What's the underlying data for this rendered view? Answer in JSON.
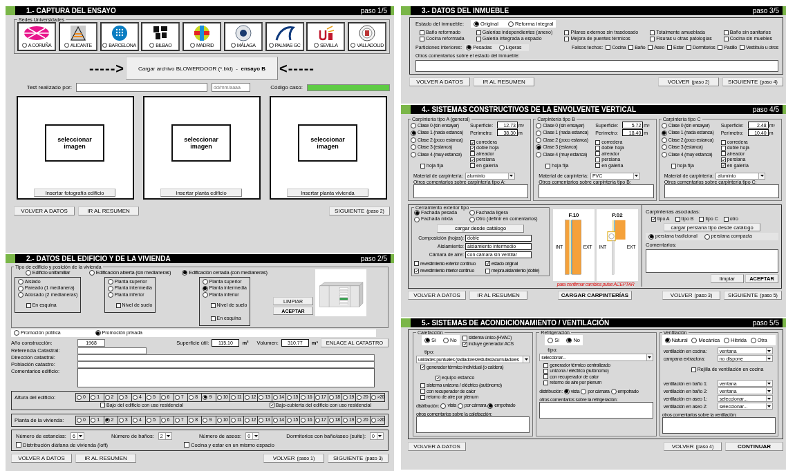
{
  "capture": {
    "title": "1.- CAPTURA DEL ENSAYO",
    "step": "paso 1/5",
    "sedes_label": "Sedes Universidades",
    "sedes": [
      {
        "label": "A CORUÑA",
        "selected": false
      },
      {
        "label": "ALICANTE",
        "selected": false
      },
      {
        "label": "BARCELONA",
        "selected": false
      },
      {
        "label": "BILBAO",
        "selected": false
      },
      {
        "label": "MADRID",
        "selected": false
      },
      {
        "label": "MÁLAGA",
        "selected": false
      },
      {
        "label": "PALMAS GC",
        "selected": false
      },
      {
        "label": "SEVILLA",
        "selected": false
      },
      {
        "label": "VALLADOLID",
        "selected": false
      }
    ],
    "arrow_left": "----->",
    "load_button": "Cargar archivo BLOWERDOOR (*.bld)  -  **ensayo B**",
    "arrow_right": "<-----",
    "tester_label": "Test realizado por:",
    "date_placeholder": "dd/mm/aaaa",
    "code_label": "Código caso:",
    "images": [
      {
        "prompt": "seleccionar imagen",
        "button": "Insertar fotografía edificio"
      },
      {
        "prompt": "seleccionar imagen",
        "button": "Insertar planta edificio"
      },
      {
        "prompt": "seleccionar imagen",
        "button": "Insertar planta vivienda"
      }
    ],
    "nav_left": [
      {
        "label": "VOLVER A DATOS",
        "strong": false
      },
      {
        "label": "IR AL RESUMEN",
        "strong": false
      }
    ],
    "nav_right": [
      {
        "label": "SIGUIENTE",
        "note": "(paso 2)",
        "strong": false
      }
    ]
  },
  "building": {
    "title": "2.- DATOS DEL EDIFICIO Y DE LA VIVIENDA",
    "step": "paso 2/5",
    "group_label": "Tipo de edificio y posición de la vivienda",
    "types": [
      {
        "label": "Edificio unifamiliar",
        "selected": false,
        "options": [
          {
            "label": "Aislado",
            "selected": false
          },
          {
            "label": "Pareado (1 medianera)",
            "selected": false
          },
          {
            "label": "Adosado (2 medianeras)",
            "selected": false
          }
        ],
        "checks": [
          {
            "label": "En esquina",
            "checked": false
          }
        ]
      },
      {
        "label": "Edificación abierta (sin medianeras)",
        "selected": false,
        "options": [
          {
            "label": "Planta superior",
            "selected": false
          },
          {
            "label": "Planta intermedia",
            "selected": false
          },
          {
            "label": "Planta inferior",
            "selected": false
          }
        ],
        "checks": [
          {
            "label": "Nivel de suelo",
            "checked": false
          }
        ]
      },
      {
        "label": "Edificación cerrada (con medianeras)",
        "selected": true,
        "options": [
          {
            "label": "Planta superior",
            "selected": false
          },
          {
            "label": "Planta intermedia",
            "selected": true
          },
          {
            "label": "Planta inferior",
            "selected": false
          }
        ],
        "checks": [
          {
            "label": "Nivel de suelo",
            "checked": false
          },
          {
            "label": "En esquina",
            "checked": false
          }
        ]
      }
    ],
    "type_buttons": [
      {
        "label": "LIMPIAR",
        "strong": false
      },
      {
        "label": "ACEPTAR",
        "strong": true
      }
    ],
    "promotion": [
      {
        "label": "Promoción pública",
        "selected": false
      },
      {
        "label": "Promoción privada",
        "selected": true
      }
    ],
    "year_label": "Año construcción:",
    "year": "1968",
    "area_label": "Superficie útil:",
    "area": "115.10",
    "area_unit": "m²",
    "volume_label": "Volumen:",
    "volume": "310.77",
    "volume_unit": "m³",
    "catastro_button": "ENLACE AL CATASTRO",
    "text_fields": [
      {
        "label": "Referencia Catastral:",
        "kind": "short"
      },
      {
        "label": "Dirección catastral:",
        "kind": "line"
      },
      {
        "label": "Población catastro:",
        "kind": "line"
      },
      {
        "label": "Comentarios edificio:",
        "kind": "area"
      }
    ],
    "height_label": "Altura del edificio:",
    "heights": [
      {
        "label": "0",
        "selected": false
      },
      {
        "label": "1",
        "selected": false
      },
      {
        "label": "2",
        "selected": false
      },
      {
        "label": "3",
        "selected": false
      },
      {
        "label": "4",
        "selected": false
      },
      {
        "label": "5",
        "selected": false
      },
      {
        "label": "6",
        "selected": false
      },
      {
        "label": "7",
        "selected": false
      },
      {
        "label": "8",
        "selected": false
      },
      {
        "label": "9",
        "selected": true
      },
      {
        "label": "10",
        "selected": false
      },
      {
        "label": "11",
        "selected": false
      },
      {
        "label": "12",
        "selected": false
      },
      {
        "label": "13",
        "selected": false
      },
      {
        "label": "14",
        "selected": false
      },
      {
        "label": "15",
        "selected": false
      },
      {
        "label": "16",
        "selected": false
      },
      {
        "label": "17",
        "selected": false
      },
      {
        "label": "18",
        "selected": false
      },
      {
        "label": "19",
        "selected": false
      },
      {
        "label": "20",
        "selected": false
      },
      {
        "label": ">20",
        "selected": false
      }
    ],
    "height_checks": [
      {
        "label": "Bajo del edificio con uso residencial",
        "checked": false
      },
      {
        "label": "Bajo-cubierta del edificio con uso residencial",
        "checked": true
      }
    ],
    "floor_label": "Planta de la vivienda:",
    "floors": [
      {
        "label": "0",
        "selected": false
      },
      {
        "label": "1",
        "selected": false
      },
      {
        "label": "2",
        "selected": true
      },
      {
        "label": "3",
        "selected": false
      },
      {
        "label": "4",
        "selected": false
      },
      {
        "label": "5",
        "selected": false
      },
      {
        "label": "6",
        "selected": false
      },
      {
        "label": "7",
        "selected": false
      },
      {
        "label": "8",
        "selected": false
      },
      {
        "label": "9",
        "selected": false
      },
      {
        "label": "10",
        "selected": false
      },
      {
        "label": "11",
        "selected": false
      },
      {
        "label": "12",
        "selected": false
      },
      {
        "label": "13",
        "selected": false
      },
      {
        "label": "14",
        "selected": false
      },
      {
        "label": "15",
        "selected": false
      },
      {
        "label": "16",
        "selected": false
      },
      {
        "label": "17",
        "selected": false
      },
      {
        "label": "18",
        "selected": false
      },
      {
        "label": "19",
        "selected": false
      },
      {
        "label": "20",
        "selected": false
      },
      {
        "label": ">20",
        "selected": false
      }
    ],
    "counts": [
      {
        "label": "Número de estancias:",
        "value": "6"
      },
      {
        "label": "Número de baños:",
        "value": "2"
      },
      {
        "label": "Número de aseos:",
        "value": "0"
      },
      {
        "label": "Dormitorios con baño/aseo (suite):",
        "value": "0"
      }
    ],
    "layout_checks": [
      {
        "label": "Distribución diáfana de vivienda (loft)",
        "checked": false
      },
      {
        "label": "Cocina y estar en un mismo espacio",
        "checked": false
      }
    ],
    "nav_left": [
      {
        "label": "VOLVER A DATOS",
        "strong": false
      },
      {
        "label": "IR AL RESUMEN",
        "strong": false
      }
    ],
    "nav_right": [
      {
        "label": "VOLVER",
        "note": "(paso 1)",
        "strong": false
      },
      {
        "label": "SIGUIENTE",
        "note": "(paso 3)",
        "strong": false
      }
    ]
  },
  "property": {
    "title": "3.- DATOS DEL INMUEBLE",
    "step": "paso 3/5",
    "state_label": "Estado del inmueble:",
    "states": [
      {
        "label": "Original",
        "selected": true
      },
      {
        "label": "Reforma integral",
        "selected": false
      }
    ],
    "features": [
      {
        "label": "Baño reformado",
        "checked": false
      },
      {
        "label": "Galerías independientes (anexo)",
        "checked": false
      },
      {
        "label": "Pilares externos sin trasdosado",
        "checked": false
      },
      {
        "label": "Totalmente amueblada",
        "checked": false
      },
      {
        "label": "Baño sin sanitarios",
        "checked": false
      },
      {
        "label": "Cocina reformada",
        "checked": false
      },
      {
        "label": "Galería integrada a espacio",
        "checked": false
      },
      {
        "label": "Mejora de puentes térmicos",
        "checked": false
      },
      {
        "label": "Fisuras u otras patologías",
        "checked": false
      },
      {
        "label": "Cocina sin muebles",
        "checked": false
      }
    ],
    "partitions_label": "Particiones interiores:",
    "partitions": [
      {
        "label": "Pesadas",
        "selected": true
      },
      {
        "label": "Ligeras",
        "selected": false
      }
    ],
    "ceilings_label": "Falsos techos:",
    "ceilings": [
      {
        "label": "Cocina",
        "checked": false
      },
      {
        "label": "Baño",
        "checked": false
      },
      {
        "label": "Aseo",
        "checked": false
      },
      {
        "label": "Estar",
        "checked": false
      },
      {
        "label": "Dormitorios",
        "checked": false
      },
      {
        "label": "Pasillo",
        "checked": false
      },
      {
        "label": "Vestíbulo u otros",
        "checked": false
      }
    ],
    "comments_label": "Otros comentarios sobre el estado del inmueble:",
    "nav_left": [
      {
        "label": "VOLVER A DATOS",
        "strong": false
      },
      {
        "label": "IR AL RESUMEN",
        "strong": false
      }
    ],
    "nav_right": [
      {
        "label": "VOLVER",
        "note": "(paso 2)",
        "strong": false
      },
      {
        "label": "SIGUIENTE",
        "note": "(paso 4)",
        "strong": false
      }
    ]
  },
  "envelope": {
    "title": "4.- SISTEMAS CONSTRUCTIVOS DE LA ENVOLVENTE VERTICAL",
    "step": "paso 4/5",
    "windows": [
      {
        "title": "Carpintería tipo A (general)",
        "classes": [
          {
            "label": "Clase 0 (sin ensayar)",
            "selected": false
          },
          {
            "label": "Clase 1 (nada estanca)",
            "selected": true
          },
          {
            "label": "Clase 2 (poco estanca)",
            "selected": false
          },
          {
            "label": "Clase 3 (estanca)",
            "selected": false
          },
          {
            "label": "Clase 4 (muy estanca)",
            "selected": false
          }
        ],
        "fixed": {
          "label": "hoja fija",
          "checked": false
        },
        "surface_label": "Superficie:",
        "surface": "12.73",
        "surface_unit": "m²",
        "perimeter_label": "Perímetro:",
        "perimeter": "38.30",
        "perimeter_unit": "m",
        "features": [
          {
            "label": "corredera",
            "checked": true
          },
          {
            "label": "doble hoja",
            "checked": true
          },
          {
            "label": "aireador",
            "checked": false
          },
          {
            "label": "persiana",
            "checked": true
          },
          {
            "label": "en galería",
            "checked": false
          }
        ],
        "material_label": "Material de carpintería:",
        "material": "aluminio",
        "comments_label": "Otros comentarios sobre carpintería tipo A:"
      },
      {
        "title": "Carpintería tipo B",
        "classes": [
          {
            "label": "Clase 0 (sin ensayar)",
            "selected": false
          },
          {
            "label": "Clase 1 (nada estanca)",
            "selected": false
          },
          {
            "label": "Clase 2 (poco estanca)",
            "selected": false
          },
          {
            "label": "Clase 3 (estanca)",
            "selected": true
          },
          {
            "label": "Clase 4 (muy estanca)",
            "selected": false
          }
        ],
        "fixed": {
          "label": "hoja fija",
          "checked": false
        },
        "surface_label": "Superficie:",
        "surface": "5.72",
        "surface_unit": "m²",
        "perimeter_label": "Perímetro:",
        "perimeter": "18.40",
        "perimeter_unit": "m",
        "features": [
          {
            "label": "corredera",
            "checked": false
          },
          {
            "label": "doble hoja",
            "checked": false
          },
          {
            "label": "aireador",
            "checked": false
          },
          {
            "label": "persiana",
            "checked": false
          },
          {
            "label": "en galería",
            "checked": false
          }
        ],
        "material_label": "Material de carpintería:",
        "material": "PVC",
        "comments_label": "Otros comentarios sobre carpintería tipo B:"
      },
      {
        "title": "Carpintería tipo C",
        "classes": [
          {
            "label": "Clase 0 (sin ensayar)",
            "selected": false
          },
          {
            "label": "Clase 1 (nada estanca)",
            "selected": true
          },
          {
            "label": "Clase 2 (poco estanca)",
            "selected": false
          },
          {
            "label": "Clase 3 (estanca)",
            "selected": false
          },
          {
            "label": "Clase 4 (muy estanca)",
            "selected": false
          }
        ],
        "fixed": {
          "label": "hoja fija",
          "checked": false
        },
        "surface_label": "Superficie:",
        "surface": "2.48",
        "surface_unit": "m²",
        "perimeter_label": "Perímetro:",
        "perimeter": "10.40",
        "perimeter_unit": "m",
        "features": [
          {
            "label": "corredera",
            "checked": false
          },
          {
            "label": "doble hoja",
            "checked": false
          },
          {
            "label": "aireador",
            "checked": false
          },
          {
            "label": "persiana",
            "checked": true
          },
          {
            "label": "en galería",
            "checked": true
          }
        ],
        "material_label": "Material de carpintería:",
        "material": "aluminio",
        "comments_label": "Otros comentarios sobre carpintería tipo C:"
      }
    ],
    "wall": {
      "group_label": "Cerramiento exterior tipo",
      "facades": [
        {
          "label": "Fachada pesada",
          "selected": true
        },
        {
          "label": "Fachada ligera",
          "selected": false
        },
        {
          "label": "Fachada mixta",
          "selected": false
        },
        {
          "label": "Otro (definir en comentarios)",
          "selected": false
        }
      ],
      "catalog_button": "cargar desde catálogo",
      "fields": [
        {
          "label": "Composición (hojas):",
          "value": "doble"
        },
        {
          "label": "Aislamiento:",
          "value": "aislamiento intermedio"
        },
        {
          "label": "Cámara de aire:",
          "value": "con cámara sin ventilar"
        }
      ],
      "checks": [
        {
          "label": "revestimiento exterior continuo",
          "checked": false
        },
        {
          "label": "estado original",
          "checked": true
        },
        {
          "label": "revestimiento interior continuo",
          "checked": true
        },
        {
          "label": "mejora aislamiento (doble)",
          "checked": false
        }
      ],
      "sections": [
        {
          "title": "F.10",
          "inside": "INT",
          "outside": "EXT",
          "kind": "wall"
        },
        {
          "title": "P.02",
          "inside": "INT",
          "outside": "EXT",
          "kind": "blind"
        }
      ],
      "note": "para confirmar cambios pulse ACEPTAR",
      "assoc_label": "Carpinterías asociadas:",
      "assoc": [
        {
          "label": "tipo A",
          "checked": true
        },
        {
          "label": "tipo B",
          "checked": false
        },
        {
          "label": "tipo C",
          "checked": false
        },
        {
          "label": "otro",
          "checked": false
        }
      ],
      "blind_button": "cargar persiana tipo desde catálogo",
      "blinds": [
        {
          "label": "persiana tradicional",
          "selected": true
        },
        {
          "label": "persiana compacta",
          "selected": false
        }
      ],
      "comments_label": "Comentarios:",
      "buttons": [
        {
          "label": "limpiar",
          "strong": false
        },
        {
          "label": "ACEPTAR",
          "strong": true
        }
      ]
    },
    "nav_left": [
      {
        "label": "VOLVER A DATOS",
        "strong": false
      },
      {
        "label": "IR AL RESUMEN",
        "strong": false
      }
    ],
    "nav_center": [
      {
        "label": "CARGAR CARPINTERÍAS",
        "strong": true
      }
    ],
    "nav_right": [
      {
        "label": "VOLVER",
        "note": "(paso 3)",
        "strong": false
      },
      {
        "label": "SIGUIENTE",
        "note": "(paso 5)",
        "strong": false
      }
    ]
  },
  "systems": {
    "title": "5.- SISTEMAS DE ACONDICIONAMIENTO / VENTILACIÓN",
    "step": "paso 5/5",
    "units": [
      {
        "label": "Calefacción",
        "switch": [
          {
            "label": "Sí",
            "selected": true
          },
          {
            "label": "No",
            "selected": false
          }
        ],
        "extras": [
          {
            "label": "sistema único (HVAC)",
            "checked": false
          },
          {
            "label": "incluye generador ACS",
            "checked": true
          }
        ],
        "type_label": "tipo:",
        "type": "unidades puntuales (radiadores/estufas/acumuladores",
        "checks": [
          {
            "label": "generador térmico individual (o caldera)",
            "checked": true,
            "children": [
              {
                "label": "equipo estanco",
                "checked": true
              }
            ]
          },
          {
            "label": "sistema unizona / eléctrico (autónomo)",
            "checked": false
          },
          {
            "label": "con recuperador de calor",
            "checked": false
          },
          {
            "label": "retorno de aire por plenum",
            "checked": false
          }
        ],
        "distribution_label": "distribución:",
        "distribution": [
          {
            "label": "vista",
            "selected": false
          },
          {
            "label": "por cámara",
            "selected": false
          },
          {
            "label": "empotrado",
            "selected": true
          }
        ],
        "comments_label": "otros comentarios sobre la calefacción:"
      },
      {
        "label": "Refrigeración",
        "switch": [
          {
            "label": "Sí",
            "selected": false
          },
          {
            "label": "No",
            "selected": true
          }
        ],
        "type_label": "tipo:",
        "type": "seleccionar...",
        "checks": [
          {
            "label": "generador térmico centralizado",
            "checked": false
          },
          {
            "label": "unizona / eléctrico (autónomo)",
            "checked": false
          },
          {
            "label": "con recuperador de calor",
            "checked": false
          },
          {
            "label": "retorno de aire por plenum",
            "checked": false
          }
        ],
        "distribution_label": "distribución:",
        "distribution": [
          {
            "label": "vista",
            "selected": true
          },
          {
            "label": "por cámara",
            "selected": false
          },
          {
            "label": "empotrado",
            "selected": false
          }
        ],
        "comments_label": "otros comentarios sobre la refrigeración:"
      }
    ],
    "ventilation": {
      "label": "Ventilación",
      "modes": [
        {
          "label": "Natural",
          "selected": true
        },
        {
          "label": "Mecánica",
          "selected": false
        },
        {
          "label": "Híbrida",
          "selected": false
        },
        {
          "label": "Otra",
          "selected": false
        }
      ],
      "rows": [
        {
          "label": "ventilación en cocina:",
          "value": "ventana"
        },
        {
          "label": "campana extractora:",
          "value": "no dispone"
        }
      ],
      "grille": {
        "label": "Rejilla de ventilación en cocina",
        "checked": false
      },
      "rows_2": [
        {
          "label": "ventilación en baño 1:",
          "value": "ventana"
        },
        {
          "label": "ventilación en baño 2:",
          "value": "ventana"
        },
        {
          "label": "ventilación en aseo 1:",
          "value": "seleccionar..."
        },
        {
          "label": "ventilación en aseo 2:",
          "value": "seleccionar..."
        }
      ],
      "comments_label": "otros comentarios sobre la ventilación:"
    },
    "nav_left": [
      {
        "label": "VOLVER A DATOS",
        "strong": false
      }
    ],
    "nav_right": [
      {
        "label": "VOLVER",
        "note": "(paso 4)",
        "strong": false
      },
      {
        "label": "CONTINUAR",
        "strong": true
      }
    ]
  }
}
